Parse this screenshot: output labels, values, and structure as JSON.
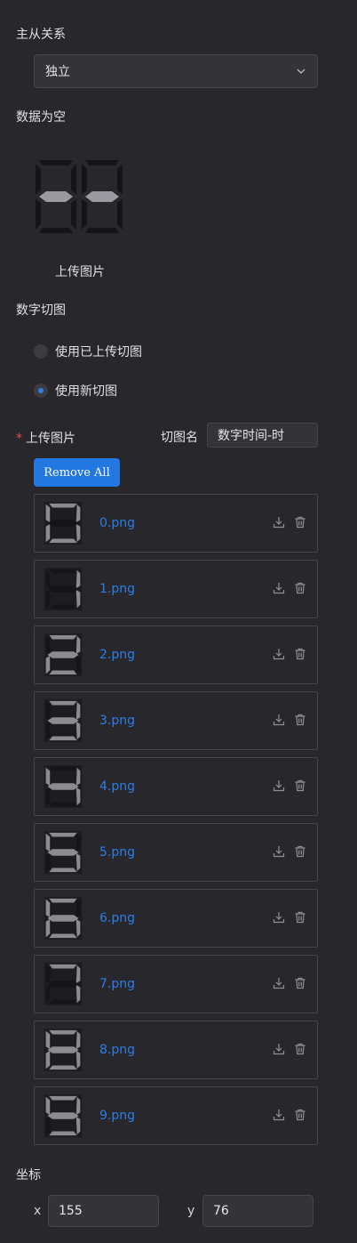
{
  "master_slave": {
    "label": "主从关系",
    "selected": "独立"
  },
  "empty_data": {
    "label": "数据为空",
    "upload_label": "上传图片"
  },
  "digit_slice": {
    "label": "数字切图",
    "options": [
      "使用已上传切图",
      "使用新切图"
    ],
    "selected_index": 1
  },
  "upload": {
    "required_mark": "*",
    "label": "上传图片",
    "slice_name_label": "切图名",
    "slice_name_value": "数字时间-时",
    "remove_all": "Remove All",
    "files": [
      "0.png",
      "1.png",
      "2.png",
      "3.png",
      "4.png",
      "5.png",
      "6.png",
      "7.png",
      "8.png",
      "9.png"
    ]
  },
  "coords": {
    "label": "坐标",
    "x_label": "x",
    "x_value": "155",
    "y_label": "y",
    "y_value": "76"
  },
  "colors": {
    "accent": "#2277e0",
    "link": "#2d7ee6",
    "required": "#ee4b4b",
    "background": "#27272c"
  }
}
